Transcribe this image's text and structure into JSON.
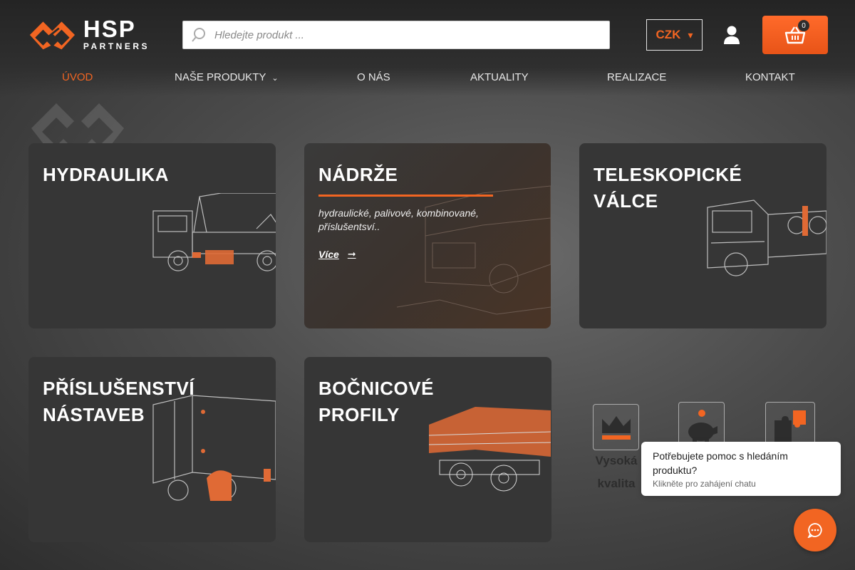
{
  "brand": {
    "name": "HSP",
    "tagline": "PARTNERS",
    "accent_color": "#f26522"
  },
  "header": {
    "search_placeholder": "Hledejte produkt ...",
    "currency": "CZK",
    "cart_count": "0"
  },
  "nav": {
    "items": [
      {
        "label": "ÚVOD",
        "active": true
      },
      {
        "label": "NAŠE PRODUKTY",
        "has_dropdown": true
      },
      {
        "label": "O NÁS"
      },
      {
        "label": "AKTUALITY"
      },
      {
        "label": "REALIZACE"
      },
      {
        "label": "KONTAKT"
      }
    ]
  },
  "cards": [
    {
      "title": "HYDRAULIKA"
    },
    {
      "title": "NÁDRŽE",
      "description": "hydraulické, palivové, kombinované, příslušentsví..",
      "more_label": "Více"
    },
    {
      "title": "TELESKOPICKÉ\nVÁLCE"
    },
    {
      "title": "PŘÍSLUŠENSTVÍ\nNÁSTAVEB"
    },
    {
      "title": "BOČNICOVÉ\nPROFILY"
    }
  ],
  "features": [
    {
      "label": "Vysoká\nkvalita",
      "icon": "crown-icon"
    },
    {
      "label": "",
      "icon": "piggy-bank-icon"
    },
    {
      "label": "",
      "icon": "puzzle-icon"
    }
  ],
  "chat": {
    "question": "Potřebujete pomoc s hledáním produktu?",
    "hint": "Klikněte pro zahájení chatu"
  }
}
